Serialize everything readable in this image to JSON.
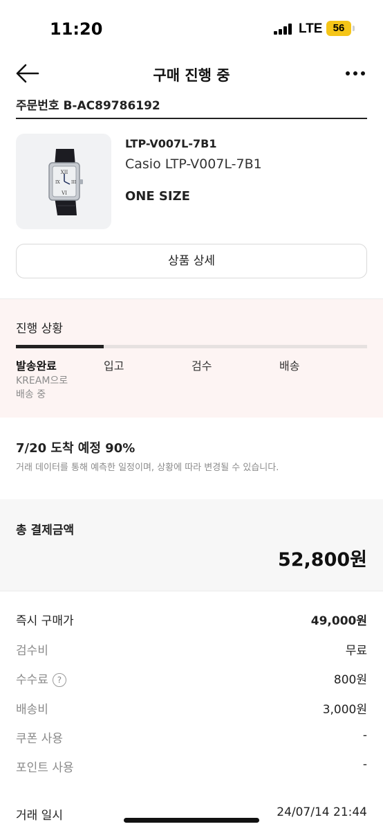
{
  "status_bar": {
    "time": "11:20",
    "network": "LTE",
    "battery": "56",
    "battery_color": "#f5c518"
  },
  "nav": {
    "title": "구매 진행 중",
    "back_icon": "arrow-left-icon",
    "more_icon": "more-horizontal-icon"
  },
  "order": {
    "number_text": "주문번호 B-AC89786192"
  },
  "product": {
    "model_code": "LTP-V007L-7B1",
    "name": "Casio LTP-V007L-7B1",
    "size": "ONE SIZE",
    "detail_button": "상품 상세"
  },
  "progress": {
    "title": "진행 상황",
    "fill_fraction": 0.25,
    "steps": [
      "발송완료",
      "입고",
      "검수",
      "배송"
    ],
    "active_step": 0,
    "active_desc_line1": "KREAM으로",
    "active_desc_line2": "배송 중"
  },
  "eta": {
    "title": "7/20 도착 예정 90%",
    "note": "거래 데이터를 통해 예측한 일정이며, 상황에 따라 변경될 수 있습니다."
  },
  "payment": {
    "total_label": "총 결제금액",
    "total_value": "52,800원",
    "rows": [
      {
        "label": "즉시 구매가",
        "value": "49,000원"
      },
      {
        "label": "검수비",
        "value": "무료"
      },
      {
        "label": "수수료",
        "value": "800원",
        "help_icon": "?"
      },
      {
        "label": "배송비",
        "value": "3,000원"
      },
      {
        "label": "쿠폰 사용",
        "value": "-"
      },
      {
        "label": "포인트 사용",
        "value": "-"
      }
    ],
    "date_label": "거래 일시",
    "date_value": "24/07/14 21:44"
  },
  "colors": {
    "progress_bg": "#fdf4f3",
    "accent": "#222222"
  }
}
